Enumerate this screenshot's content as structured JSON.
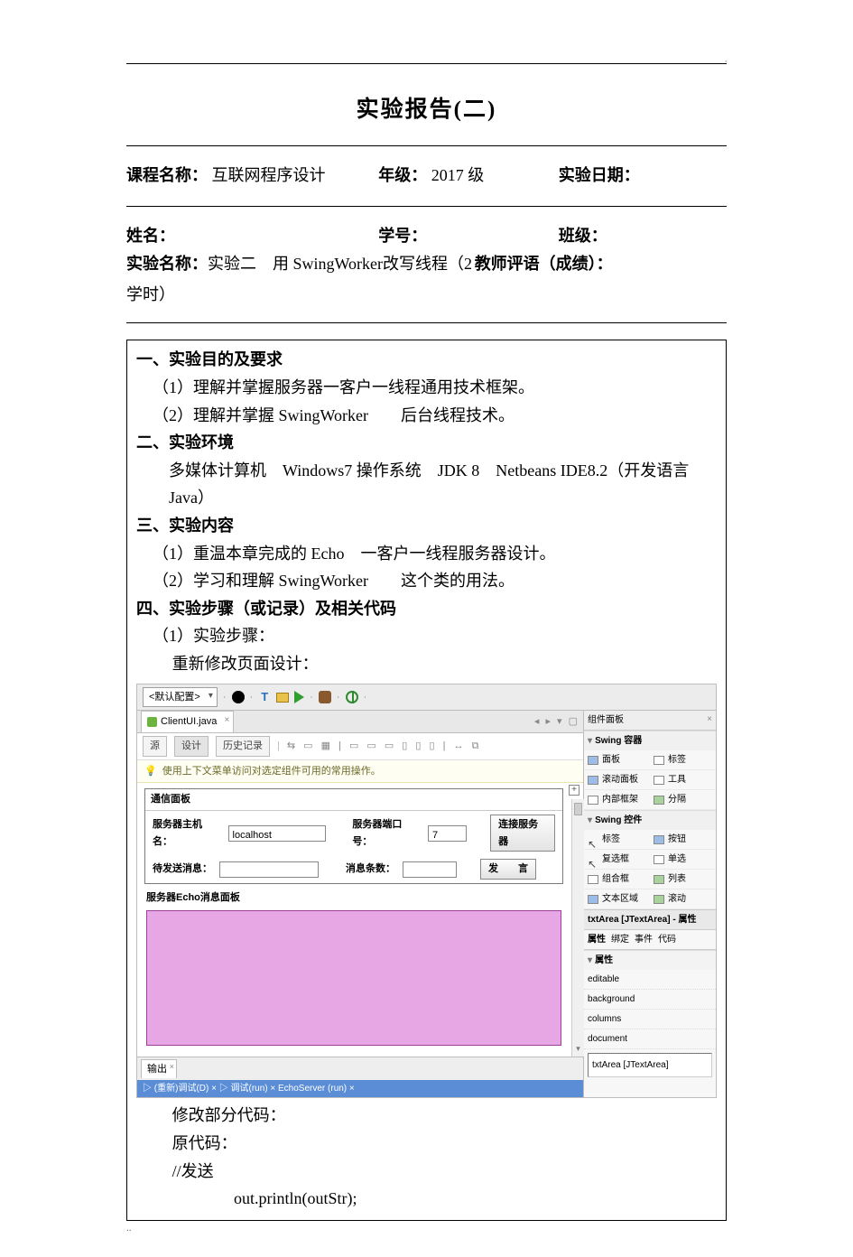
{
  "doc_title": "实验报告(二)",
  "meta": {
    "course_label": "课程名称：",
    "course_value": "互联网程序设计",
    "grade_label": "年级：",
    "grade_value": "2017 级",
    "date_label": "实验日期：",
    "name_label": "姓名：",
    "id_label": "学号：",
    "class_label": "班级：",
    "exp_name_label": "实验名称：",
    "exp_name_value": "实验二　用 SwingWorker改写线程（2 学时）",
    "teacher_label": "教师评语（成绩）："
  },
  "sections": {
    "s1_head": "一、实验目的及要求",
    "s1_l1": "（1）理解并掌握服务器一客户一线程通用技术框架。",
    "s1_l2": "（2）理解并掌握 SwingWorker　　后台线程技术。",
    "s2_head": "二、实验环境",
    "s2_body": "多媒体计算机　Windows7 操作系统　JDK 8　Netbeans IDE8.2（开发语言Java）",
    "s3_head": "三、实验内容",
    "s3_l1": "（1）重温本章完成的 Echo　一客户一线程服务器设计。",
    "s3_l2": "（2）学习和理解 SwingWorker　　这个类的用法。",
    "s4_head": "四、实验步骤（或记录）及相关代码",
    "s4_l1": "（1）实验步骤：",
    "s4_l2": "重新修改页面设计：",
    "after_ide_l1": "修改部分代码：",
    "after_ide_l2": "原代码：",
    "after_ide_l3": "//发送",
    "after_ide_l4": "out.println(outStr);"
  },
  "ide": {
    "config_label": "<默认配置>",
    "editor_tab": "ClientUI.java",
    "sub_source": "源",
    "sub_design": "设计",
    "sub_history": "历史记录",
    "sub_icons": "⇆ ▭ ▦ | ▭ ▭ ▭ ▯ ▯ ▯ | ↔ ⧉",
    "tip_text": "使用上下文菜单访问对选定组件可用的常用操作。",
    "nav_icons": "◂ ▸ ▾ ▢",
    "panel1_title": "通信面板",
    "host_label": "服务器主机名：",
    "host_value": "localhost",
    "port_label": "服务器端口号：",
    "port_value": "7",
    "connect_btn": "连接服务器",
    "send_label": "待发送消息：",
    "count_label": "消息条数：",
    "send_btn": "发　　言",
    "panel2_title": "服务器Echo消息面板",
    "output_tab": "输出",
    "output_strip": "▷ (重新)调试(D)  ×  ▷  调试(run)  ×  EchoServer (run)  ×",
    "palette": {
      "tab": "组件面板",
      "sec_containers": "Swing 容器",
      "items_containers": [
        {
          "txt": "面板",
          "ico": "blue"
        },
        {
          "txt": "标签",
          "ico": "list"
        },
        {
          "txt": "滚动面板",
          "ico": "blue"
        },
        {
          "txt": "工具",
          "ico": "list"
        },
        {
          "txt": "内部框架",
          "ico": "list"
        },
        {
          "txt": "分隔",
          "ico": "green"
        }
      ],
      "sec_controls": "Swing 控件",
      "items_controls": [
        {
          "txt": "标签",
          "ico": "orange",
          "cursor": true
        },
        {
          "txt": "按钮",
          "ico": "blue"
        },
        {
          "txt": "复选框",
          "ico": "list",
          "cursor": true
        },
        {
          "txt": "单选",
          "ico": "list"
        },
        {
          "txt": "组合框",
          "ico": "list"
        },
        {
          "txt": "列表",
          "ico": "green"
        },
        {
          "txt": "文本区域",
          "ico": "blue"
        },
        {
          "txt": "滚动",
          "ico": "green"
        }
      ],
      "prop_header": "txtArea [JTextArea] - 属性",
      "prop_tabs": [
        "属性",
        "绑定",
        "事件",
        "代码"
      ],
      "prop_sec": "属性",
      "prop_rows": [
        "editable",
        "background",
        "columns",
        "document"
      ],
      "prop_footer": "txtArea [JTextArea]"
    }
  },
  "footer_dots": "..",
  "corner": "'"
}
